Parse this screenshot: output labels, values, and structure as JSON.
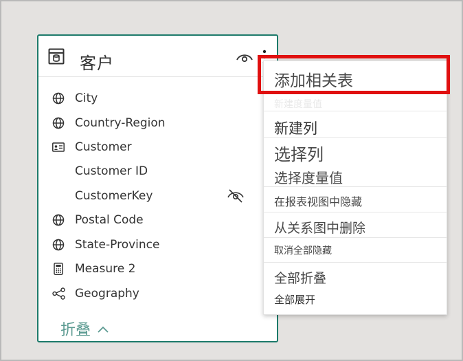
{
  "table": {
    "title": "客户",
    "fields": [
      {
        "label": "City",
        "icon": "globe-icon"
      },
      {
        "label": "Country-Region",
        "icon": "globe-icon"
      },
      {
        "label": "Customer",
        "icon": "id-card-icon"
      },
      {
        "label": "Customer ID",
        "icon": ""
      },
      {
        "label": "CustomerKey",
        "icon": "",
        "hidden": true
      },
      {
        "label": "Postal Code",
        "icon": "globe-icon"
      },
      {
        "label": "State-Province",
        "icon": "globe-icon"
      },
      {
        "label": "Measure 2",
        "icon": "calculator-icon"
      },
      {
        "label": "Geography",
        "icon": "hierarchy-icon"
      }
    ],
    "collapse_label": "折叠"
  },
  "menu": {
    "items": [
      {
        "label": "添加相关表"
      },
      {
        "label": "新建度量值"
      },
      {
        "label": "新建列"
      },
      {
        "label": "选择列"
      },
      {
        "label": "选择度量值"
      },
      {
        "label": "在报表视图中隐藏"
      },
      {
        "label": "从关系图中删除"
      },
      {
        "label": "取消全部隐藏"
      },
      {
        "label": "全部折叠"
      },
      {
        "label": "全部展开"
      }
    ]
  },
  "colors": {
    "card_border": "#1c7a6a",
    "highlight": "#e01010",
    "collapse_link": "#5b9a91"
  }
}
